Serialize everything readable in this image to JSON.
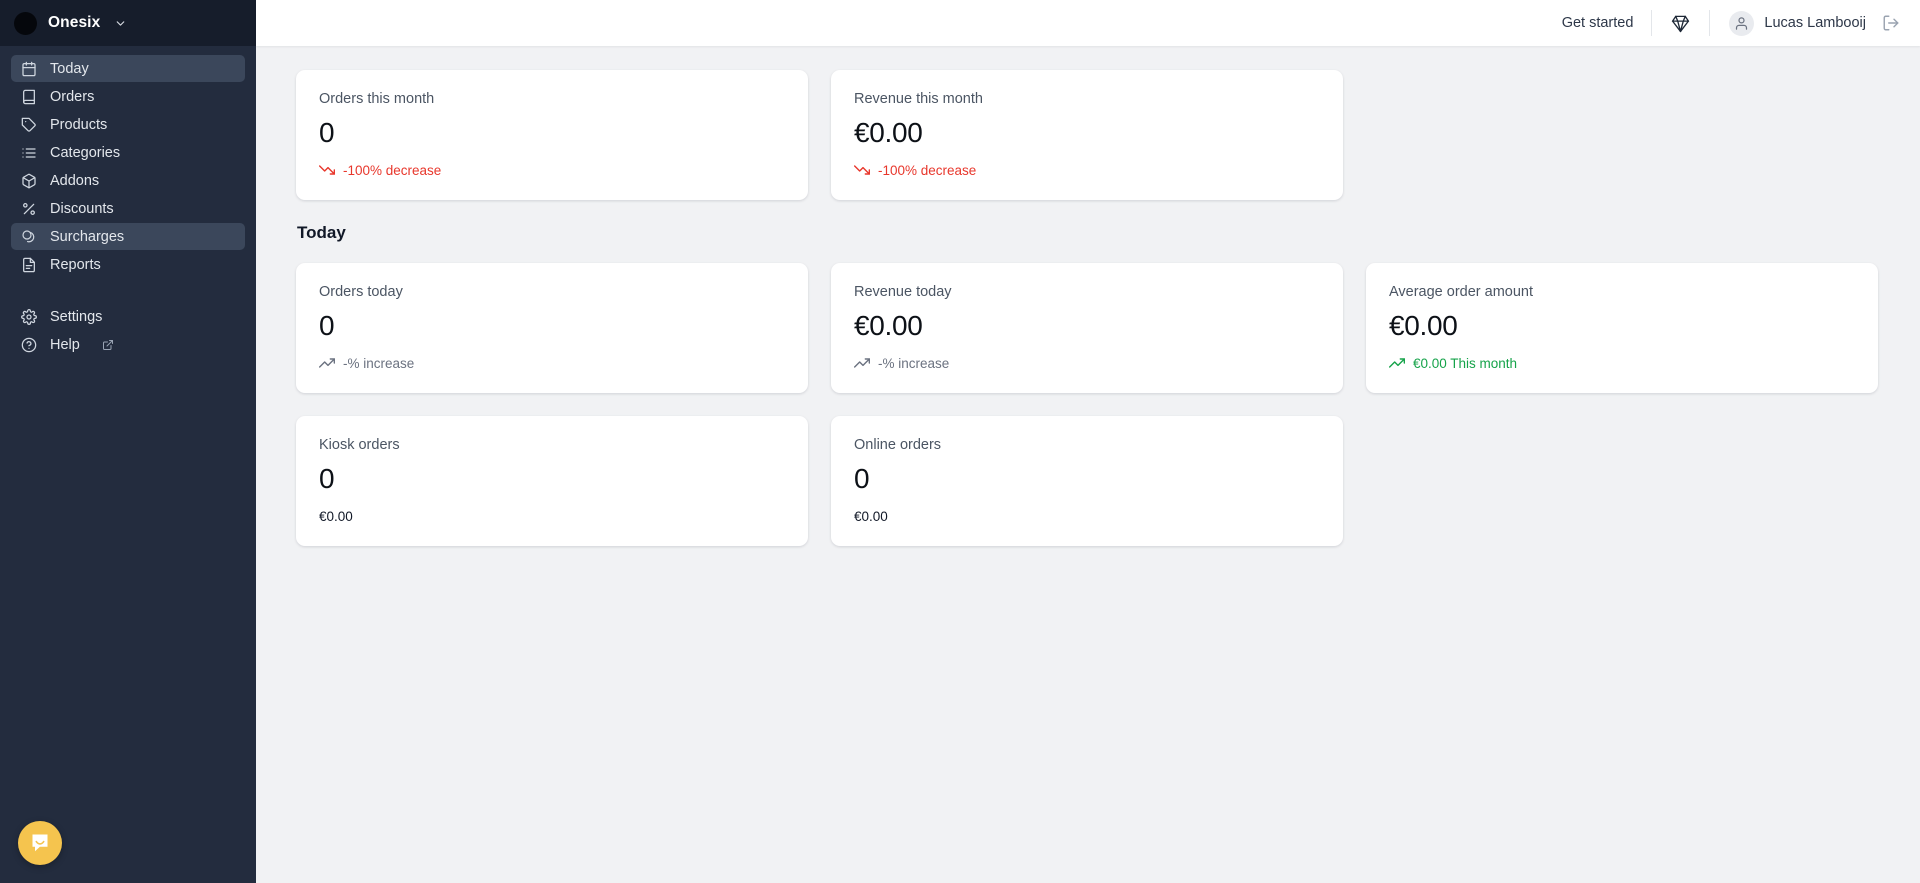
{
  "sidebar": {
    "org": {
      "name": "Onesix",
      "avatar_icon": "org-avatar",
      "chevron_icon": "chevron-down-icon"
    },
    "items": [
      {
        "label": "Today",
        "icon": "calendar-icon",
        "active": true,
        "external": false
      },
      {
        "label": "Orders",
        "icon": "book-icon",
        "active": false,
        "external": false
      },
      {
        "label": "Products",
        "icon": "tag-icon",
        "active": false,
        "external": false
      },
      {
        "label": "Categories",
        "icon": "list-icon",
        "active": false,
        "external": false
      },
      {
        "label": "Addons",
        "icon": "package-icon",
        "active": false,
        "external": false
      },
      {
        "label": "Discounts",
        "icon": "percent-icon",
        "active": false,
        "external": false
      },
      {
        "label": "Surcharges",
        "icon": "coins-icon",
        "active": true,
        "external": false
      },
      {
        "label": "Reports",
        "icon": "document-icon",
        "active": false,
        "external": false
      }
    ],
    "footer_items": [
      {
        "label": "Settings",
        "icon": "gear-icon",
        "external": false
      },
      {
        "label": "Help",
        "icon": "question-mark-icon",
        "external": true
      }
    ],
    "chat_launcher": {
      "icon": "chat-bubble-icon",
      "color": "#f5c44e"
    }
  },
  "topbar": {
    "get_started": "Get started",
    "gem_icon": "gem-icon",
    "user": {
      "name": "Lucas Lambooij",
      "avatar_icon": "user-avatar-icon"
    },
    "logout_icon": "logout-icon"
  },
  "main": {
    "month_cards": [
      {
        "label": "Orders this month",
        "value": "0",
        "trend_text": "-100% decrease",
        "trend_dir": "down",
        "trend_color": "#e8372c",
        "trend_icon": "trending-down-icon"
      },
      {
        "label": "Revenue this month",
        "value": "€0.00",
        "trend_text": "-100% decrease",
        "trend_dir": "down",
        "trend_color": "#e8372c",
        "trend_icon": "trending-down-icon"
      }
    ],
    "section_title": "Today",
    "today_cards": [
      {
        "label": "Orders today",
        "value": "0",
        "trend_text": "-% increase",
        "trend_dir": "flat",
        "trend_color": "#6b7280",
        "trend_icon": "trending-up-icon"
      },
      {
        "label": "Revenue today",
        "value": "€0.00",
        "trend_text": "-% increase",
        "trend_dir": "flat",
        "trend_color": "#6b7280",
        "trend_icon": "trending-up-icon"
      },
      {
        "label": "Average order amount",
        "value": "€0.00",
        "trend_text": "€0.00 This month",
        "trend_dir": "up",
        "trend_color": "#16a34a",
        "trend_icon": "trending-up-icon"
      }
    ],
    "channel_cards": [
      {
        "label": "Kiosk orders",
        "value": "0",
        "sub": "€0.00"
      },
      {
        "label": "Online orders",
        "value": "0",
        "sub": "€0.00"
      }
    ]
  },
  "colors": {
    "sidebar_bg": "#232c3e",
    "sidebar_top_bg": "#161d2b",
    "sidebar_active": "#3b475b",
    "page_bg": "#f1f2f4",
    "card_bg": "#ffffff",
    "danger": "#e8372c",
    "success": "#16a34a",
    "muted": "#6b7280",
    "chat_accent": "#f5c44e"
  }
}
